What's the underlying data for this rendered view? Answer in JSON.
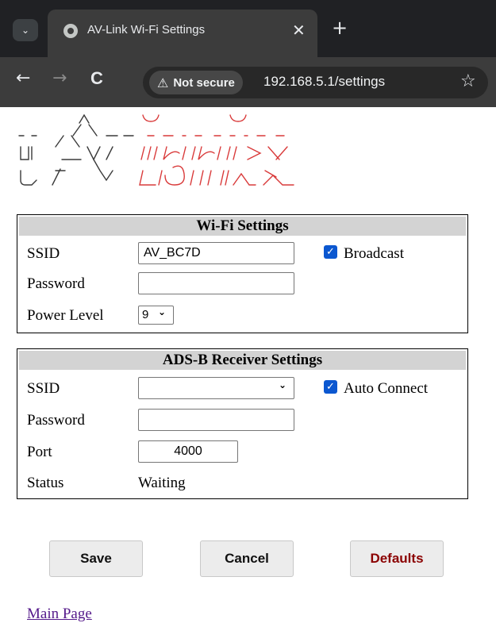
{
  "browser": {
    "tab_title": "AV-Link Wi-Fi Settings",
    "security_label": "Not secure",
    "url": "192.168.5.1/settings",
    "icons": {
      "tab_menu": "chevron-down-icon",
      "favicon": "globe-icon",
      "close": "close-icon",
      "new_tab": "plus-icon",
      "back": "arrow-left-icon",
      "forward": "arrow-right-icon",
      "reload": "reload-icon",
      "warning": "warning-icon",
      "bookmark": "star-icon"
    },
    "glyphs": {
      "chevron": "⌄",
      "close": "✕",
      "plus": "+",
      "back": "←",
      "forward": "→",
      "reload": "C",
      "warning": "⚠",
      "star": "☆"
    }
  },
  "logo": {
    "text": "AVLink",
    "colors": {
      "av": "#3a3a3a",
      "link": "#d93a3a"
    }
  },
  "wifi_settings": {
    "header": "Wi-Fi Settings",
    "ssid_label": "SSID",
    "ssid_value": "AV_BC7D",
    "broadcast_label": "Broadcast",
    "broadcast_checked": true,
    "password_label": "Password",
    "password_value": "",
    "power_label": "Power Level",
    "power_value": "9"
  },
  "adsb_settings": {
    "header": "ADS-B Receiver Settings",
    "ssid_label": "SSID",
    "ssid_value": "",
    "auto_connect_label": "Auto Connect",
    "auto_connect_checked": true,
    "password_label": "Password",
    "password_value": "",
    "port_label": "Port",
    "port_value": "4000",
    "status_label": "Status",
    "status_value": "Waiting"
  },
  "buttons": {
    "save": "Save",
    "cancel": "Cancel",
    "defaults": "Defaults"
  },
  "links": {
    "main_page": "Main Page"
  },
  "colors": {
    "chrome_dark": "#202124",
    "chrome_toolbar": "#3c3c3c",
    "checkbox": "#0b57d0",
    "panel_header": "#d3d3d3",
    "defaults_text": "#8b0000",
    "link": "#551a8b"
  }
}
